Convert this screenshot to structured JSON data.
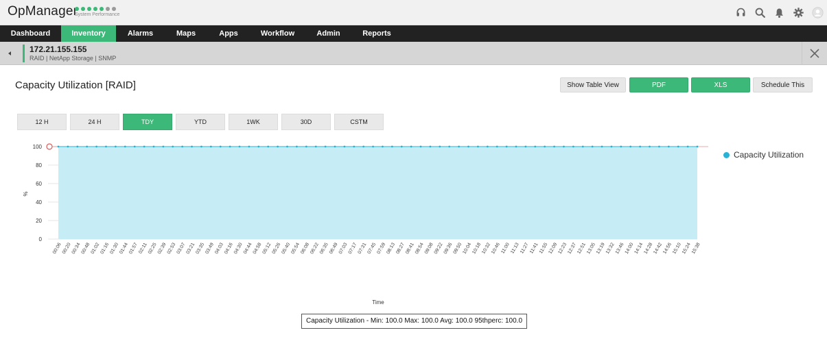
{
  "header": {
    "brand": "OpManager",
    "brand_sub": "System Performance",
    "status_dots": [
      "#3cb878",
      "#3cb878",
      "#3cb878",
      "#3cb878",
      "#3cb878",
      "#9a9a9a",
      "#9a9a9a"
    ],
    "icons": [
      "headset-icon",
      "search-icon",
      "bell-icon",
      "gear-icon",
      "avatar-icon"
    ]
  },
  "nav": {
    "items": [
      {
        "label": "Dashboard",
        "active": false
      },
      {
        "label": "Inventory",
        "active": true
      },
      {
        "label": "Alarms",
        "active": false
      },
      {
        "label": "Maps",
        "active": false
      },
      {
        "label": "Apps",
        "active": false
      },
      {
        "label": "Workflow",
        "active": false
      },
      {
        "label": "Admin",
        "active": false
      },
      {
        "label": "Reports",
        "active": false
      }
    ]
  },
  "device": {
    "ip": "172.21.155.155",
    "meta": "RAID | NetApp Storage  | SNMP"
  },
  "page": {
    "title": "Capacity Utilization [RAID]",
    "buttons": {
      "table_view": "Show Table View",
      "pdf": "PDF",
      "xls": "XLS",
      "schedule": "Schedule This"
    },
    "ranges": [
      {
        "label": "12 H",
        "active": false
      },
      {
        "label": "24 H",
        "active": false
      },
      {
        "label": "TDY",
        "active": true
      },
      {
        "label": "YTD",
        "active": false
      },
      {
        "label": "1WK",
        "active": false
      },
      {
        "label": "30D",
        "active": false
      },
      {
        "label": "CSTM",
        "active": false
      }
    ],
    "stats": "Capacity Utilization - Min: 100.0 Max: 100.0 Avg: 100.0 95thperc: 100.0"
  },
  "colors": {
    "accent": "#3cb878",
    "area_fill": "#c6ecf5",
    "series": "#27b3d6",
    "threshold": "#e05a5a"
  },
  "chart_data": {
    "type": "area",
    "xlabel": "Time",
    "ylabel": "%",
    "ylim": [
      0,
      100
    ],
    "yticks": [
      0,
      20,
      40,
      60,
      80,
      100
    ],
    "grid": true,
    "legend_position": "right",
    "x": [
      "00:06",
      "00:20",
      "00:34",
      "00:48",
      "01:02",
      "01:16",
      "01:30",
      "01:44",
      "01:57",
      "02:11",
      "02:25",
      "02:39",
      "02:53",
      "03:07",
      "03:21",
      "03:35",
      "03:49",
      "04:03",
      "04:16",
      "04:30",
      "04:44",
      "04:58",
      "05:12",
      "05:26",
      "05:40",
      "05:54",
      "06:08",
      "06:22",
      "06:35",
      "06:49",
      "07:03",
      "07:17",
      "07:31",
      "07:45",
      "07:59",
      "08:13",
      "08:27",
      "08:41",
      "08:54",
      "09:08",
      "09:22",
      "09:36",
      "09:50",
      "10:04",
      "10:18",
      "10:32",
      "10:46",
      "11:00",
      "11:13",
      "11:27",
      "11:41",
      "11:55",
      "12:09",
      "12:23",
      "12:37",
      "12:51",
      "13:05",
      "13:19",
      "13:32",
      "13:46",
      "14:00",
      "14:14",
      "14:28",
      "14:42",
      "14:56",
      "15:10",
      "15:24",
      "15:38"
    ],
    "series": [
      {
        "name": "Capacity Utilization",
        "values": [
          100,
          100,
          100,
          100,
          100,
          100,
          100,
          100,
          100,
          100,
          100,
          100,
          100,
          100,
          100,
          100,
          100,
          100,
          100,
          100,
          100,
          100,
          100,
          100,
          100,
          100,
          100,
          100,
          100,
          100,
          100,
          100,
          100,
          100,
          100,
          100,
          100,
          100,
          100,
          100,
          100,
          100,
          100,
          100,
          100,
          100,
          100,
          100,
          100,
          100,
          100,
          100,
          100,
          100,
          100,
          100,
          100,
          100,
          100,
          100,
          100,
          100,
          100,
          100,
          100,
          100,
          100,
          100
        ]
      }
    ],
    "threshold": 100
  }
}
